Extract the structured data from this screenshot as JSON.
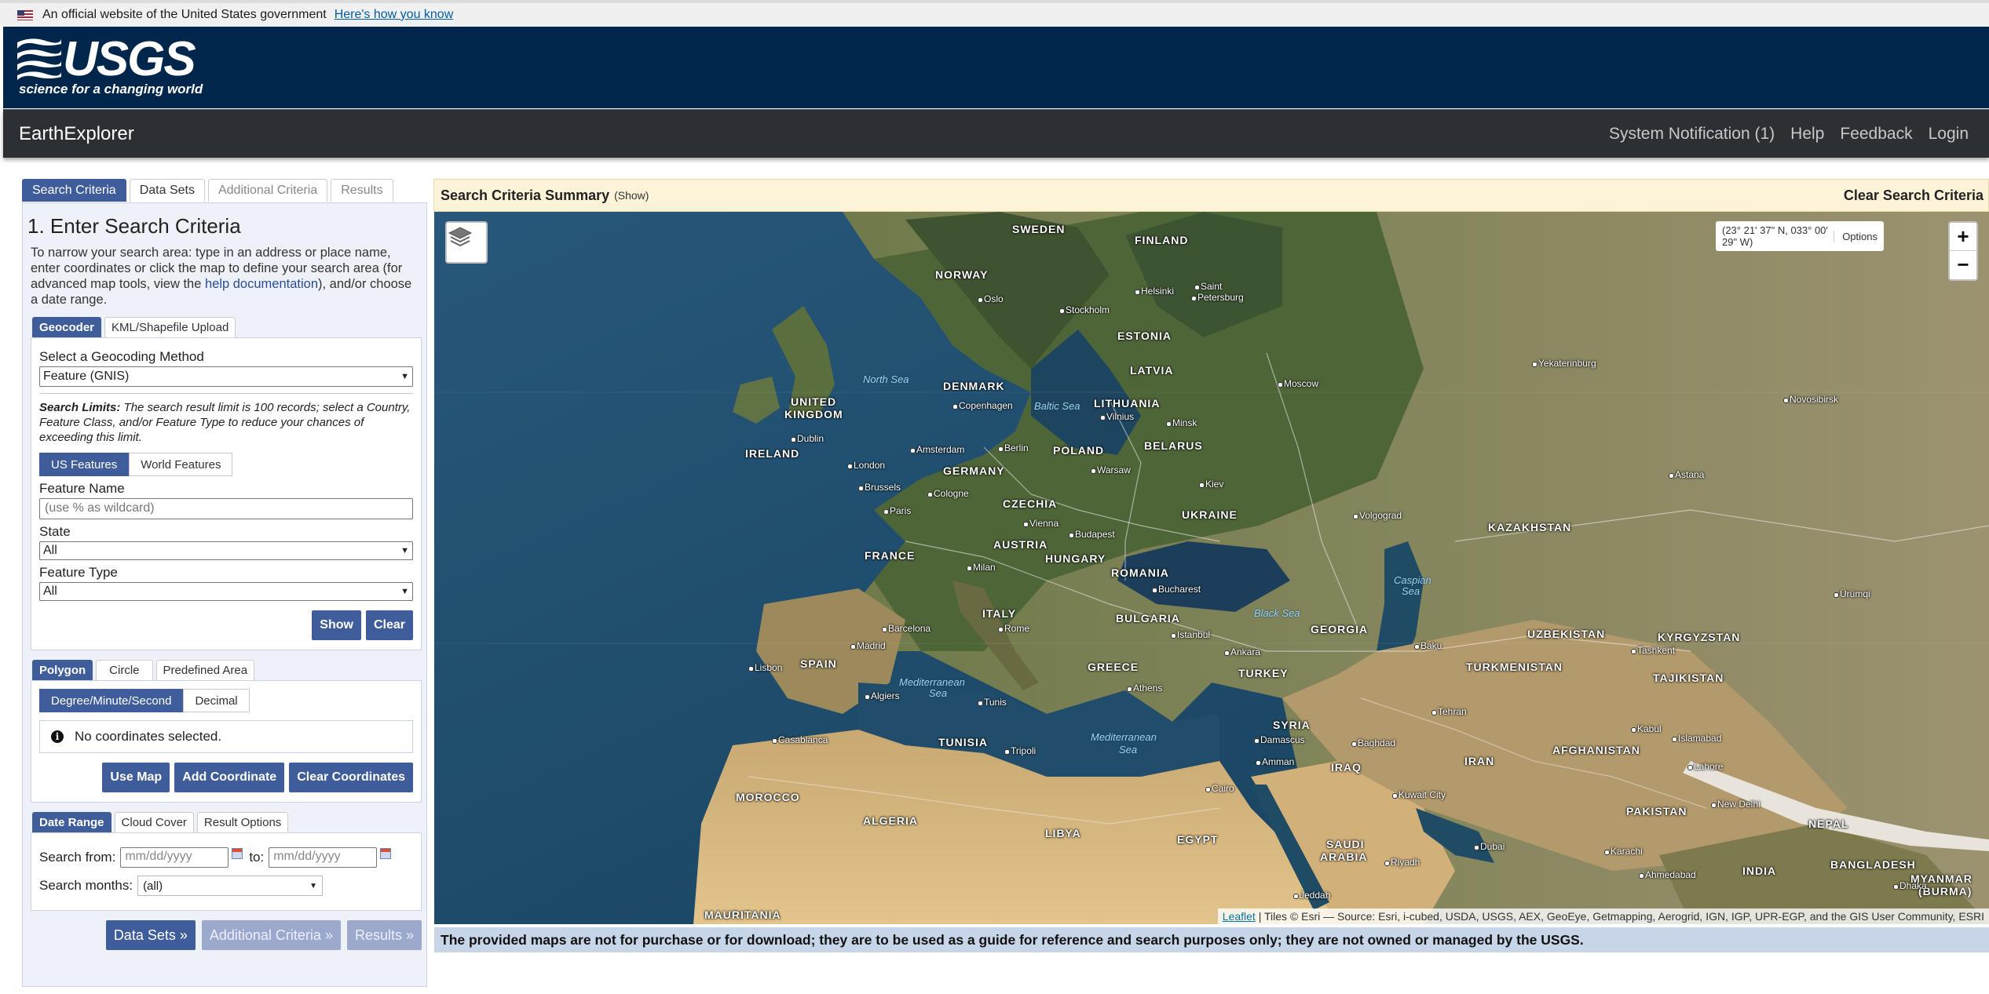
{
  "gov_banner": {
    "text": "An official website of the United States government",
    "link": "Here's how you know"
  },
  "header": {
    "logo_word": "USGS",
    "logo_tagline": "science for a changing world"
  },
  "app_bar": {
    "title": "EarthExplorer",
    "links": [
      "System Notification (1)",
      "Help",
      "Feedback",
      "Login"
    ]
  },
  "left": {
    "tabs": [
      "Search Criteria",
      "Data Sets",
      "Additional Criteria",
      "Results"
    ],
    "heading": "1. Enter Search Criteria",
    "intro_before": "To narrow your search area: type in an address or place name, enter coordinates or click the map to define your search area (for advanced map tools, view the ",
    "intro_link": "help documentation",
    "intro_after": "), and/or choose a date range.",
    "geo_tabs": [
      "Geocoder",
      "KML/Shapefile Upload"
    ],
    "geocoding_label": "Select a Geocoding Method",
    "geocoding_value": "Feature (GNIS)",
    "limits_label": "Search Limits:",
    "limits_text": " The search result limit is 100 records; select a Country, Feature Class, and/or Feature Type to reduce your chances of exceeding this limit.",
    "feature_toggle": [
      "US Features",
      "World Features"
    ],
    "feature_name_label": "Feature Name",
    "feature_name_placeholder": "(use % as wildcard)",
    "state_label": "State",
    "state_value": "All",
    "feature_type_label": "Feature Type",
    "feature_type_value": "All",
    "show_btn": "Show",
    "clear_btn": "Clear",
    "area_tabs": [
      "Polygon",
      "Circle",
      "Predefined Area"
    ],
    "coord_toggle": [
      "Degree/Minute/Second",
      "Decimal"
    ],
    "no_coords": "No coordinates selected.",
    "coord_buttons": [
      "Use Map",
      "Add Coordinate",
      "Clear Coordinates"
    ],
    "date_tabs": [
      "Date Range",
      "Cloud Cover",
      "Result Options"
    ],
    "search_from": "Search from:",
    "from_placeholder": "mm/dd/yyyy",
    "to": "to:",
    "to_placeholder": "mm/dd/yyyy",
    "search_months": "Search months:",
    "months_value": "(all)",
    "nav_buttons": [
      "Data Sets »",
      "Additional Criteria »",
      "Results »"
    ]
  },
  "summary": {
    "title": "Search Criteria Summary",
    "show": "(Show)",
    "clear": "Clear Search Criteria"
  },
  "map": {
    "coords": "(23° 21' 37\" N, 033° 00' 29\" W)",
    "options": "Options",
    "zoom_in": "+",
    "zoom_out": "−",
    "attrib_link": "Leaflet",
    "attrib_text": " | Tiles © Esri — Source: Esri, i-cubed, USDA, USGS, AEX, GeoEye, Getmapping, Aerogrid, IGN, IGP, UPR-EGP, and the GIS User Community, ESRI",
    "countries": [
      "SWEDEN",
      "FINLAND",
      "NORWAY",
      "ESTONIA",
      "LATVIA",
      "DENMARK",
      "LITHUANIA",
      "UNITED",
      "KINGDOM",
      "IRELAND",
      "BELARUS",
      "POLAND",
      "GERMANY",
      "CZECHIA",
      "UKRAINE",
      "FRANCE",
      "AUSTRIA",
      "HUNGARY",
      "ROMANIA",
      "KAZAKHSTAN",
      "ITALY",
      "BULGARIA",
      "GEORGIA",
      "UZBEKISTAN",
      "KYRGYZSTAN",
      "SPAIN",
      "GREECE",
      "TURKEY",
      "TURKMENISTAN",
      "TAJIKISTAN",
      "TUNISIA",
      "SYRIA",
      "IRAQ",
      "IRAN",
      "AFGHANISTAN",
      "MOROCCO",
      "ALGERIA",
      "LIBYA",
      "EGYPT",
      "SAUDI",
      "ARABIA",
      "PAKISTAN",
      "NEPAL",
      "INDIA",
      "BANGLADESH",
      "MYANMAR",
      "(BURMA)",
      "MAURITANIA"
    ],
    "cities": [
      "Oslo",
      "Stockholm",
      "Helsinki",
      "Saint",
      "Petersburg",
      "Moscow",
      "Yekaterinburg",
      "Novosibirsk",
      "Copenhagen",
      "Vilnius",
      "Minsk",
      "Dublin",
      "London",
      "Amsterdam",
      "Berlin",
      "Warsaw",
      "Brussels",
      "Cologne",
      "Paris",
      "Kiev",
      "Astana",
      "Volgograd",
      "Vienna",
      "Budapest",
      "Milan",
      "Bucharest",
      "Barcelona",
      "Rome",
      "Istanbul",
      "Ankara",
      "Madrid",
      "Lisbon",
      "Baku",
      "Tashkent",
      "Tehran",
      "Kabul",
      "Islamabad",
      "Algiers",
      "Tunis",
      "Athens",
      "Casablanca",
      "Tripoli",
      "Damascus",
      "Amman",
      "Baghdad",
      "Lahore",
      "New Delhi",
      "Kuwait City",
      "Cairo",
      "Riyadh",
      "Dubai",
      "Jeddah",
      "Karachi",
      "Ahmedabad",
      "Dhaka",
      "Ürümqi"
    ],
    "seas": [
      "North Sea",
      "Baltic Sea",
      "Black Sea",
      "Caspian",
      "Sea",
      "Mediterranean",
      "Sea",
      "Mediterranean",
      "Sea"
    ]
  },
  "disclaimer": "The provided maps are not for purchase or for download; they are to be used as a guide for reference and search purposes only; they are not owned or managed by the USGS."
}
